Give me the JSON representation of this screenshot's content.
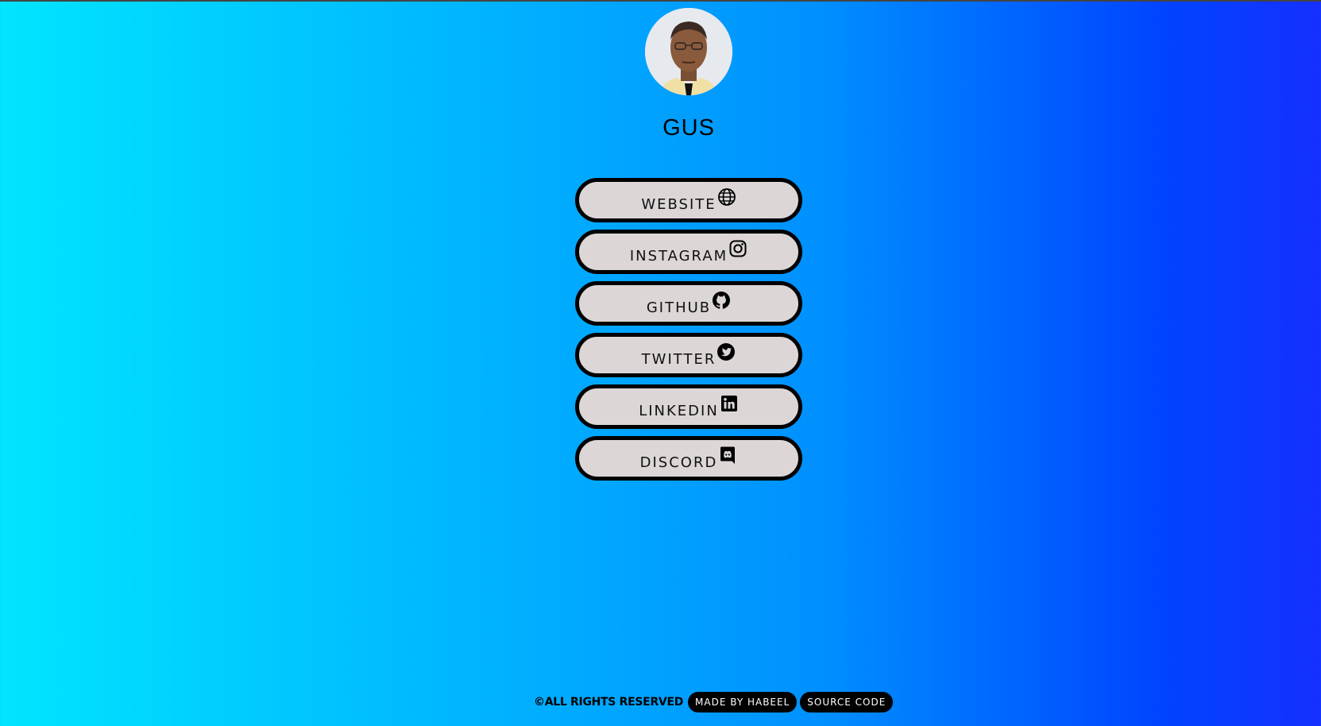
{
  "profile": {
    "name": "GUS",
    "avatar_icon": "profile-photo"
  },
  "links": [
    {
      "label": "WEBSITE",
      "icon": "globe-icon"
    },
    {
      "label": "INSTAGRAM",
      "icon": "instagram-icon"
    },
    {
      "label": "GITHUB",
      "icon": "github-icon"
    },
    {
      "label": "TWITTER",
      "icon": "twitter-icon"
    },
    {
      "label": "LINKEDIN",
      "icon": "linkedin-icon"
    },
    {
      "label": "DISCORD",
      "icon": "discord-icon"
    }
  ],
  "footer": {
    "copyright": "©ALL RIGHTS RESERVED",
    "made_by": "MADE BY HABEEL",
    "source_code": "SOURCE CODE"
  },
  "colors": {
    "gradient_start": "#00e5ff",
    "gradient_end": "#1530ff",
    "button_fill": "#dcd6d6",
    "button_border": "#000000"
  }
}
